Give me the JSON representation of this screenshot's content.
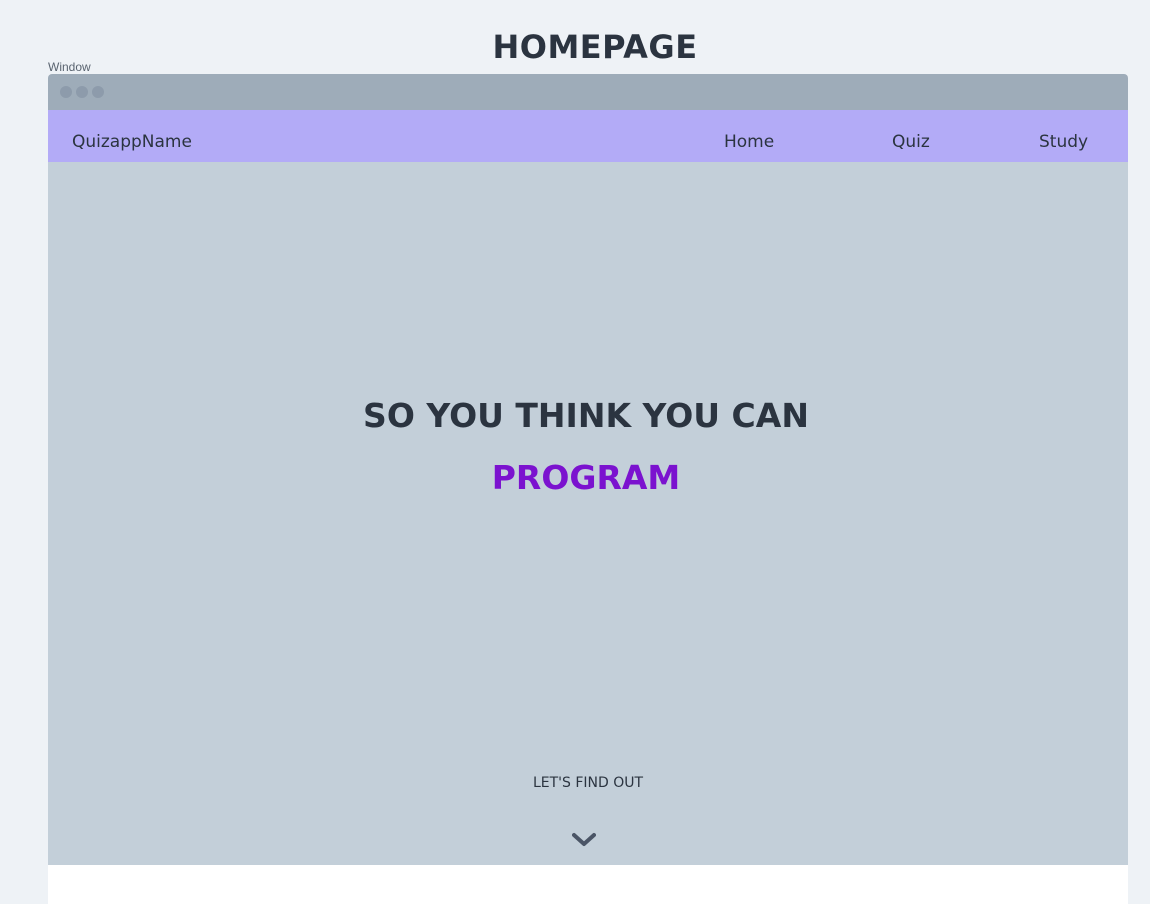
{
  "page_title": "HOMEPAGE",
  "frame_label": "Window",
  "window": {
    "controls": [
      "window-dot",
      "window-dot",
      "window-dot"
    ]
  },
  "navbar": {
    "brand": "QuizappName",
    "links": [
      {
        "label": "Home"
      },
      {
        "label": "Quiz"
      },
      {
        "label": "Study"
      }
    ]
  },
  "hero": {
    "title": "SO YOU THINK YOU CAN",
    "highlight": "PROGRAM",
    "cta": "LET'S FIND OUT",
    "cta_icon": "chevron-down-icon"
  },
  "colors": {
    "background": "#eef2f6",
    "titlebar": "#9eacb9",
    "navbar": "#b3abf7",
    "hero": "#c3cfd9",
    "text": "#2b3440",
    "accent": "#7b12cf"
  }
}
